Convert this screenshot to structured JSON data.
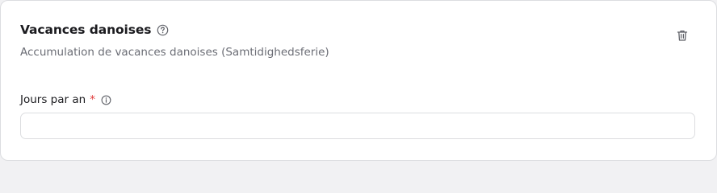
{
  "section": {
    "title": "Vacances danoises",
    "subtitle": "Accumulation de vacances danoises (Samtidighedsferie)",
    "title_help_icon": "question-circle-icon",
    "delete_icon": "trash-icon"
  },
  "field": {
    "label": "Jours par an",
    "required_marker": "*",
    "info_icon": "info-circle-icon",
    "value": "",
    "placeholder": ""
  },
  "colors": {
    "title_text": "#1b1b1f",
    "subtitle_text": "#6b6d75",
    "required": "#e03b3b",
    "border": "#dcdde0",
    "icon": "#5f6168"
  }
}
